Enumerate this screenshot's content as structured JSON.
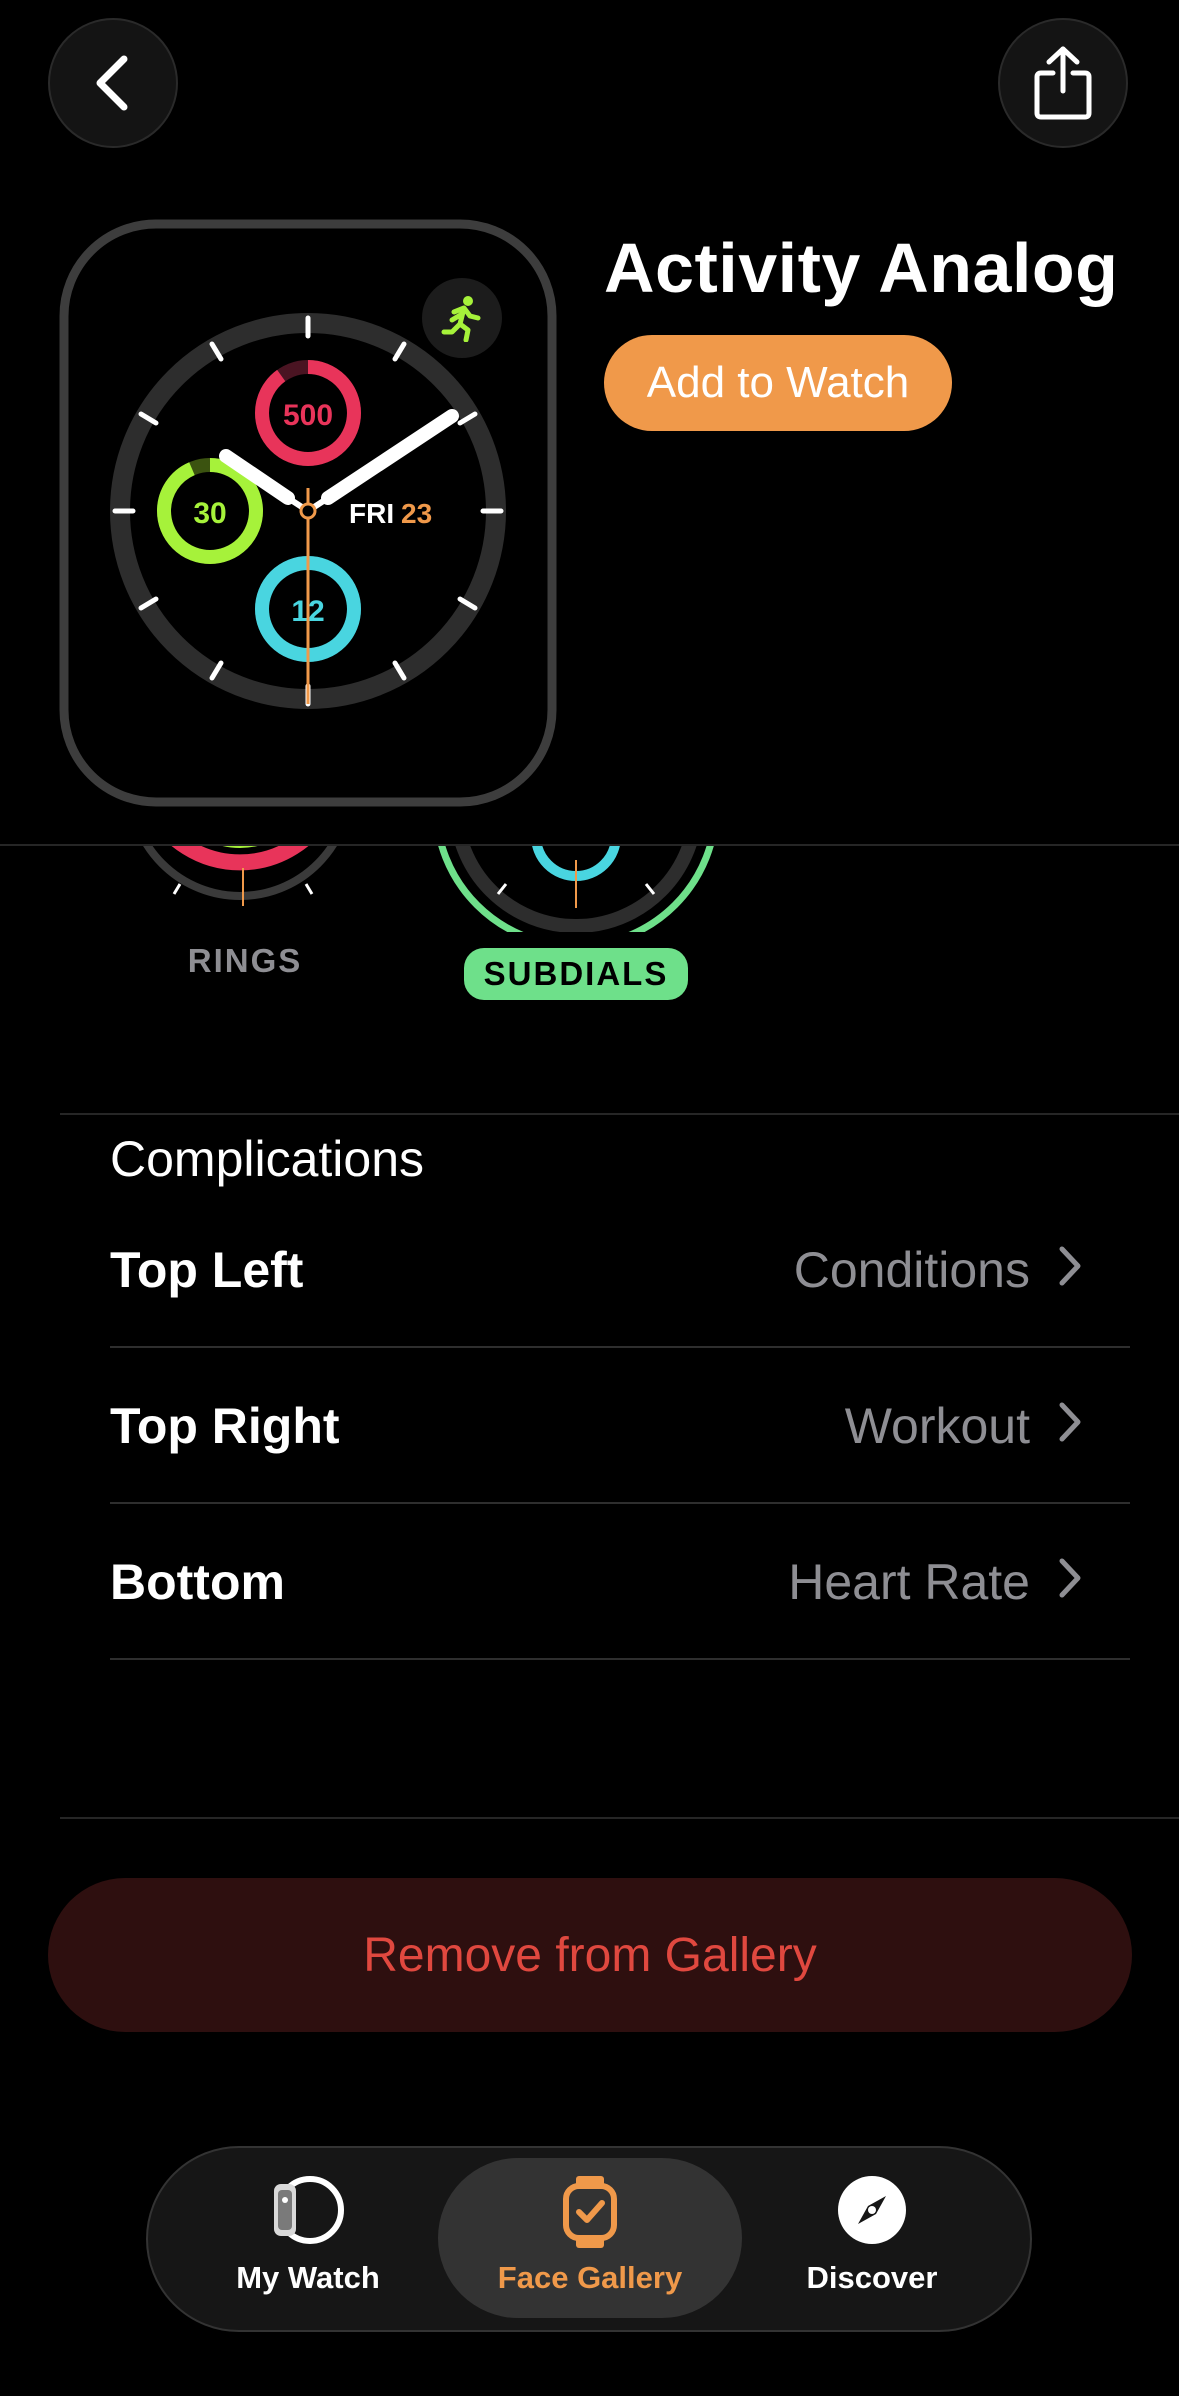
{
  "header": {
    "back_icon": "chevron-left-icon",
    "share_icon": "share-icon"
  },
  "face": {
    "title": "Activity Analog",
    "add_button": "Add to Watch",
    "preview": {
      "move_value": "500",
      "exercise_value": "30",
      "stand_value": "12",
      "day": "FRI",
      "date": "23",
      "corner_icon": "running-figure-icon"
    }
  },
  "styles": {
    "items": [
      {
        "label": "RINGS",
        "selected": false
      },
      {
        "label": "SUBDIALS",
        "selected": true
      }
    ]
  },
  "complications": {
    "title": "Complications",
    "rows": [
      {
        "label": "Top Left",
        "value": "Conditions"
      },
      {
        "label": "Top Right",
        "value": "Workout"
      },
      {
        "label": "Bottom",
        "value": "Heart Rate"
      }
    ]
  },
  "remove_button": "Remove from Gallery",
  "tabbar": {
    "tabs": [
      {
        "label": "My Watch",
        "icon": "watch-icon"
      },
      {
        "label": "Face Gallery",
        "icon": "watch-face-check-icon",
        "active": true
      },
      {
        "label": "Discover",
        "icon": "compass-icon"
      }
    ]
  },
  "colors": {
    "accent": "#f0994a",
    "move": "#e8345a",
    "exercise": "#a6f23a",
    "stand": "#49d5e0",
    "destructive": "#e0483f"
  }
}
